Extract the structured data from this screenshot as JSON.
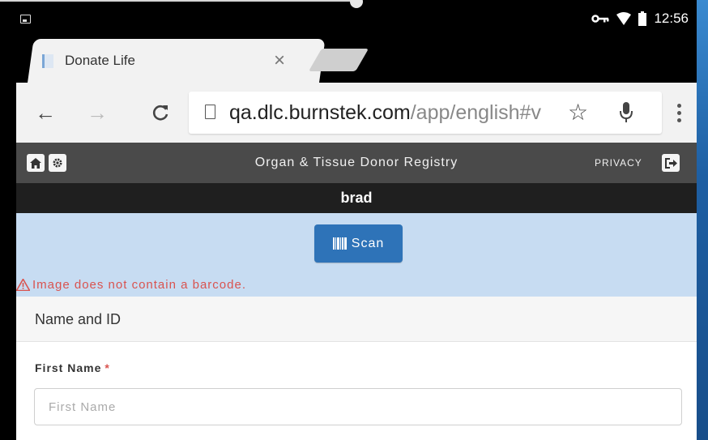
{
  "status_bar": {
    "time": "12:56",
    "icons": [
      "image-notification-icon",
      "key-icon",
      "wifi-icon",
      "battery-icon"
    ]
  },
  "browser": {
    "tab": {
      "title": "Donate Life",
      "close": "×"
    },
    "toolbar": {
      "back": "←",
      "forward": "→",
      "reload": "C",
      "star": "☆"
    },
    "omnibox": {
      "url_host": "qa.dlc.burnstek.com",
      "url_path": "/app/english#v"
    }
  },
  "app": {
    "header": {
      "title": "Organ & Tissue Donor Registry",
      "privacy": "PRIVACY"
    },
    "user": {
      "name": "brad"
    },
    "scan": {
      "button_label": "Scan",
      "error": "Image does not contain a barcode.",
      "error_color": "#d9534f",
      "button_color": "#2e73b8"
    },
    "section": {
      "title": "Name and ID"
    },
    "form": {
      "first_name": {
        "label": "First Name",
        "required_mark": "*",
        "placeholder": "First Name",
        "value": ""
      }
    }
  }
}
